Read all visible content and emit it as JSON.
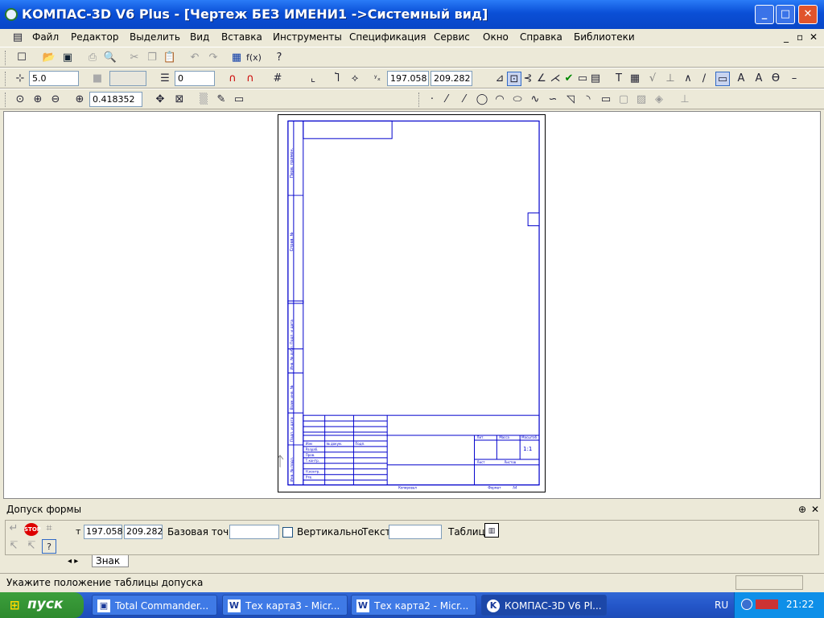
{
  "window": {
    "title": "КОМПАС-3D V6 Plus - [Чертеж БЕЗ ИМЕНИ1 ->Системный вид]",
    "min": "_",
    "max": "□",
    "close": "✕"
  },
  "menubar": {
    "items": [
      "Файл",
      "Редактор",
      "Выделить",
      "Вид",
      "Вставка",
      "Инструменты",
      "Спецификация",
      "Сервис",
      "Окно",
      "Справка",
      "Библиотеки"
    ],
    "mdi": [
      "_",
      "▫",
      "✕"
    ]
  },
  "toolbar2": {
    "step": "5.0",
    "layer": "0",
    "x": "197.058",
    "y": "209.282"
  },
  "toolbar3": {
    "zoom": "0.418352"
  },
  "sheet": {
    "title_block": {
      "row_labels": [
        "Изм",
        "Лист",
        "№ докум.",
        "Подп.",
        "Дата",
        "Разраб.",
        "Пров.",
        "Т.контр.",
        "Н.контр.",
        "Утв."
      ],
      "col_labels": [
        "Лит.",
        "Масса",
        "Масштаб"
      ],
      "scale": "1:1",
      "sheet_label": "Лист",
      "sheets_label": "Листов",
      "copied": "Копировал",
      "format": "Формат",
      "format_value": "A4"
    },
    "side_stamps": [
      "Перв. примен.",
      "Справ. №",
      "Подп. и дата",
      "Инв. № дубл.",
      "Взам. инв. №",
      "Подп. и дата",
      "Инв. № подл."
    ]
  },
  "panel": {
    "title": "Допуск формы",
    "pin": "⊕",
    "close": "✕",
    "x": "197.058",
    "y": "209.282",
    "base_point_label": "Базовая точка",
    "vertical_label": "Вертикально",
    "text_label": "Текст",
    "table_label": "Таблица",
    "tab": "Знак",
    "t_label": "т"
  },
  "status": {
    "message": "Укажите положение таблицы допуска"
  },
  "taskbar": {
    "start": "пуск",
    "tasks": [
      "Total Commander...",
      "Тех карта3 - Micr...",
      "Тех карта2 - Micr...",
      "КОМПАС-3D V6 Pl..."
    ],
    "lang": "RU",
    "time": "21:22"
  },
  "colors": {
    "title_blue": "#0a4fd6",
    "frame_blue": "#0000cc",
    "start_green": "#3c9f3c"
  }
}
